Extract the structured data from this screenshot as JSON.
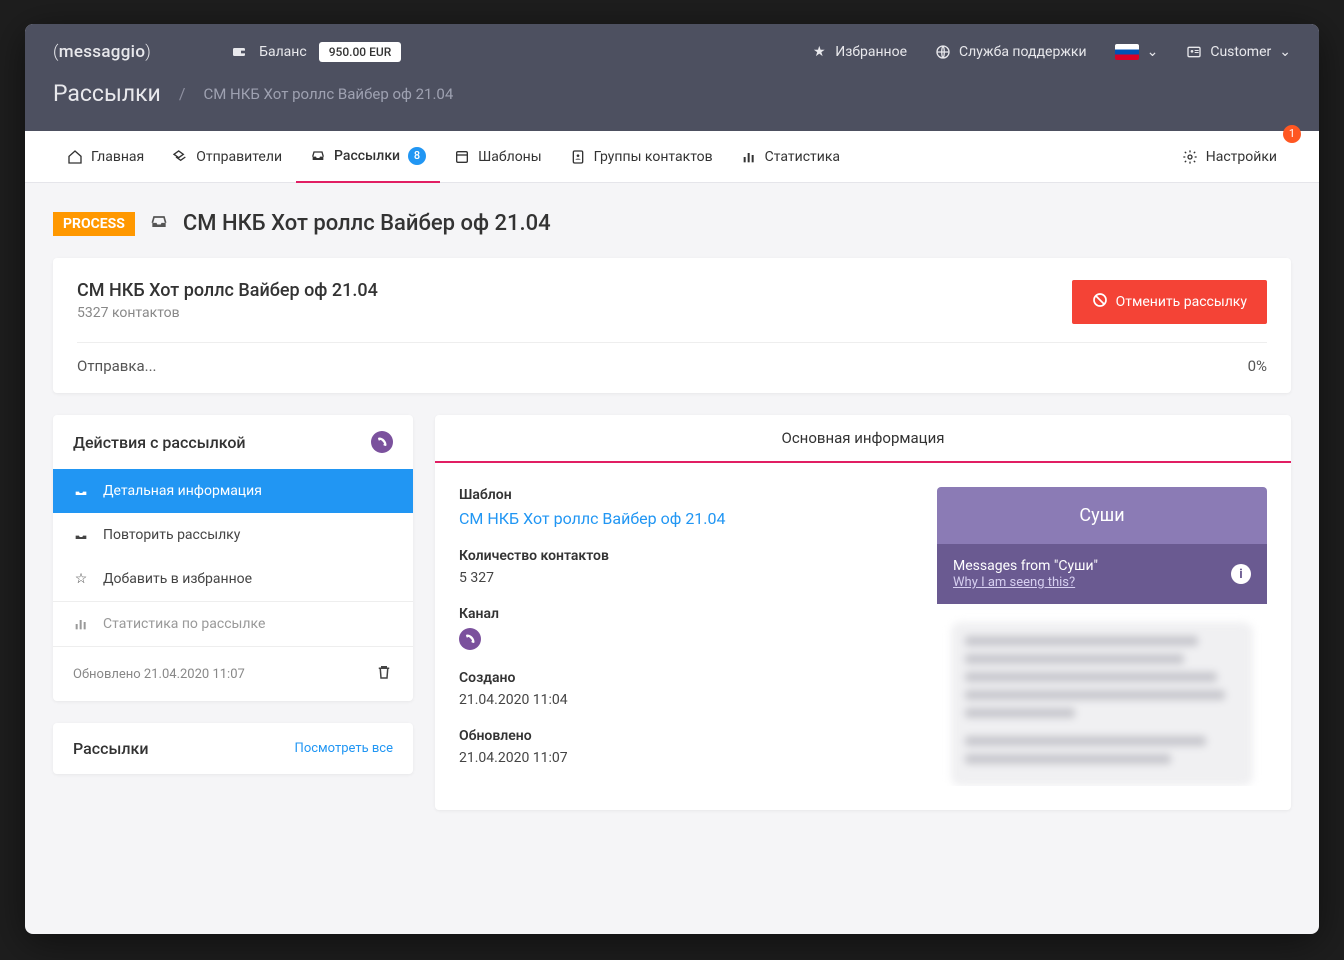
{
  "header": {
    "logo": "messaggio",
    "balance_label": "Баланс",
    "balance_amount": "950.00 EUR",
    "favorites": "Избранное",
    "support": "Служба поддержки",
    "customer": "Customer"
  },
  "breadcrumb": {
    "root": "Рассылки",
    "page": "СМ НКБ Хот роллс Вайбер оф 21.04"
  },
  "nav": {
    "home": "Главная",
    "senders": "Отправители",
    "campaigns": "Рассылки",
    "campaigns_badge": "8",
    "templates": "Шаблоны",
    "groups": "Группы контактов",
    "stats": "Статистика",
    "settings": "Настройки",
    "settings_badge": "1"
  },
  "page": {
    "status": "PROCESS",
    "title": "СМ НКБ Хот роллс Вайбер оф 21.04"
  },
  "topcard": {
    "title": "СМ НКБ Хот роллс Вайбер оф 21.04",
    "contacts": "5327 контактов",
    "cancel": "Отменить рассылку",
    "sending": "Отправка...",
    "pct": "0%"
  },
  "actions": {
    "title": "Действия с рассылкой",
    "detail": "Детальная информация",
    "repeat": "Повторить рассылку",
    "fav": "Добавить в избранное",
    "stats": "Статистика по рассылке",
    "updated": "Обновлено 21.04.2020 11:07"
  },
  "panel2": {
    "title": "Рассылки",
    "view_all": "Посмотреть все"
  },
  "right": {
    "tab": "Основная информация",
    "template_label": "Шаблон",
    "template_value": "СМ НКБ Хот роллс Вайбер оф 21.04",
    "count_label": "Количество контактов",
    "count_value": "5 327",
    "channel_label": "Канал",
    "created_label": "Создано",
    "created_value": "21.04.2020 11:04",
    "updated_label": "Обновлено",
    "updated_value": "21.04.2020 11:07"
  },
  "preview": {
    "name": "Суши",
    "from": "Messages from \"Суши\"",
    "why": "Why I am seeng this?"
  }
}
